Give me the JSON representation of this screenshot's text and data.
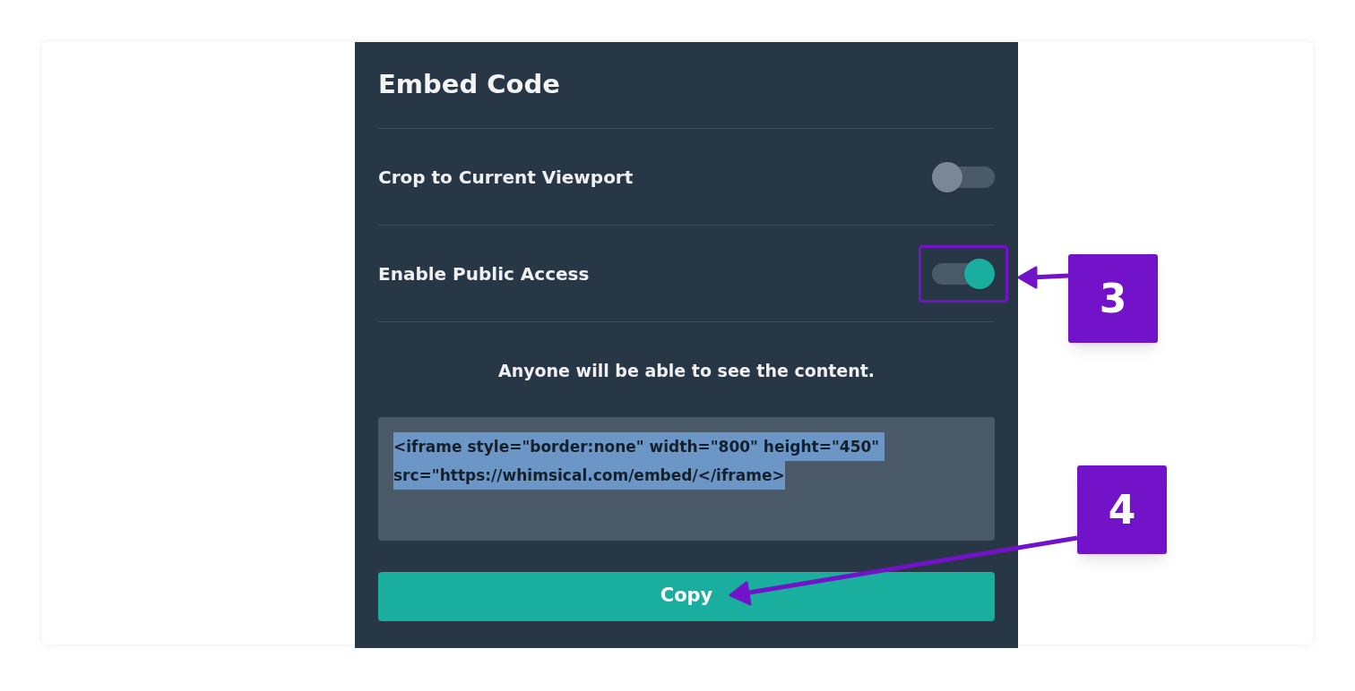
{
  "dialog": {
    "title": "Embed Code",
    "toggles": [
      {
        "label": "Crop to Current Viewport",
        "on": false,
        "highlighted": false
      },
      {
        "label": "Enable Public Access",
        "on": true,
        "highlighted": true
      }
    ],
    "notice": "Anyone will be able to see the content.",
    "code": {
      "lines": [
        "<iframe style=\"border:none\" width=\"800\" height=\"450\" ",
        "src=\"https://whimsical.com/embed/</iframe>"
      ],
      "selected": true
    },
    "button": "Copy"
  },
  "annotations": [
    {
      "label": "3"
    },
    {
      "label": "4"
    }
  ]
}
